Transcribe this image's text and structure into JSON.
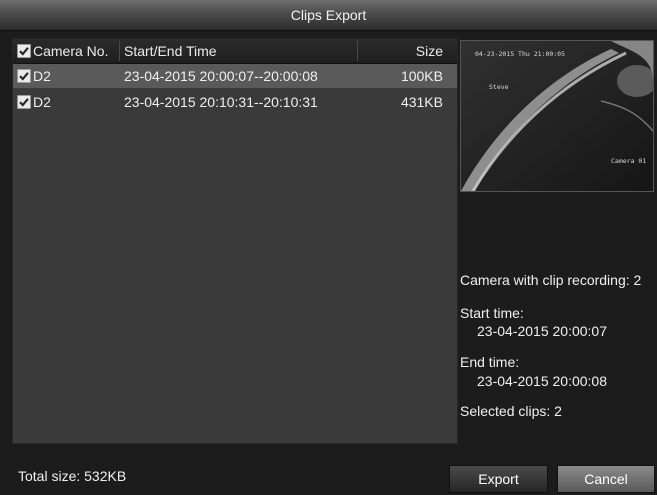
{
  "window": {
    "title": "Clips Export"
  },
  "table": {
    "columns": [
      "Camera No.",
      "Start/End Time",
      "Size"
    ],
    "rows": [
      {
        "camera": "D2",
        "time": "23-04-2015 20:00:07--20:00:08",
        "size": "100KB",
        "checked": true,
        "selected": true
      },
      {
        "camera": "D2",
        "time": "23-04-2015 20:10:31--20:10:31",
        "size": "431KB",
        "checked": true,
        "selected": false
      }
    ]
  },
  "preview": {
    "timestamp": "04-23-2015 Thu 21:00:05",
    "label_name": "Steve",
    "camera_label": "Camera 01"
  },
  "details": {
    "camera_with_clip": "Camera with clip recording: 2",
    "start_label": "Start time:",
    "start_value": "23-04-2015 20:00:07",
    "end_label": "End time:",
    "end_value": "23-04-2015 20:00:08",
    "selected_clips": "Selected clips: 2"
  },
  "footer": {
    "total_size": "Total size: 532KB",
    "export_label": "Export",
    "cancel_label": "Cancel"
  }
}
